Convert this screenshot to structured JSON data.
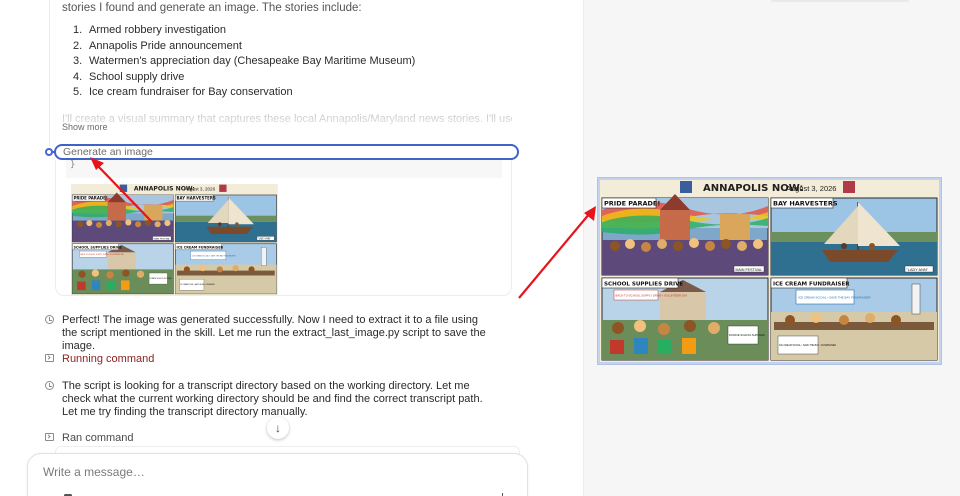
{
  "chat": {
    "intro_text": "stories I found and generate an image. The stories include:",
    "stories": [
      {
        "num": "1.",
        "text": "Armed robbery investigation"
      },
      {
        "num": "2.",
        "text": "Annapolis Pride announcement"
      },
      {
        "num": "3.",
        "text": "Watermen's appreciation day (Chesapeake Bay Maritime Museum)"
      },
      {
        "num": "4.",
        "text": "School supply drive"
      },
      {
        "num": "5.",
        "text": "Ice cream fundraiser for Bay conservation"
      }
    ],
    "faded_text": "I'll create a visual summary that captures these local Annapolis/Maryland news stories. I'll use the",
    "show_more": "Show more",
    "tool_label": "Generate an image",
    "tool_result_char": "}",
    "message_1": "Perfect! The image was generated successfully. Now I need to extract it to a file using the script mentioned in the skill. Let me run the extract_last_image.py script to save the image.",
    "running_command": "Running command",
    "message_2": "The script is looking for a transcript directory based on the working directory. Let me check what the current working directory should be and find the correct transcript path. Let me try finding the transcript directory manually.",
    "ran_command": "Ran command",
    "scroll_down_icon": "arrow-down-icon",
    "composer_placeholder": "Write a message…"
  },
  "comic": {
    "masthead": "ANNAPOLIS NOW:",
    "date": "August 3, 2026",
    "panels": [
      {
        "title": "PRIDE PARADE!",
        "caption": "MAIN FESTIVAL"
      },
      {
        "title": "BAY HARVESTERS",
        "caption": "\"LADY ANN\""
      },
      {
        "title": "SCHOOL SUPPLIES DRIVE",
        "caption": "BACK-TO-SCHOOL SUPPLY DRIVE • VOLUNTEER DAY",
        "extra": "DONATE SCHOOL SUPPLIES"
      },
      {
        "title": "ICE CREAM FUNDRAISER",
        "caption": "ICE CREAM SOCIAL • SAVE THE BAY FUNDRAISER",
        "extra": "ICE CREAM SOCIAL • SAVE THE BAY • FUNDRAISER"
      }
    ],
    "colors": {
      "panel_border": "#2a2a2a",
      "masthead_bg": "#f3ecd9",
      "accent_red": "#c0392b",
      "arrow_red": "#e8141b",
      "highlight_blue": "#4162c9"
    }
  }
}
